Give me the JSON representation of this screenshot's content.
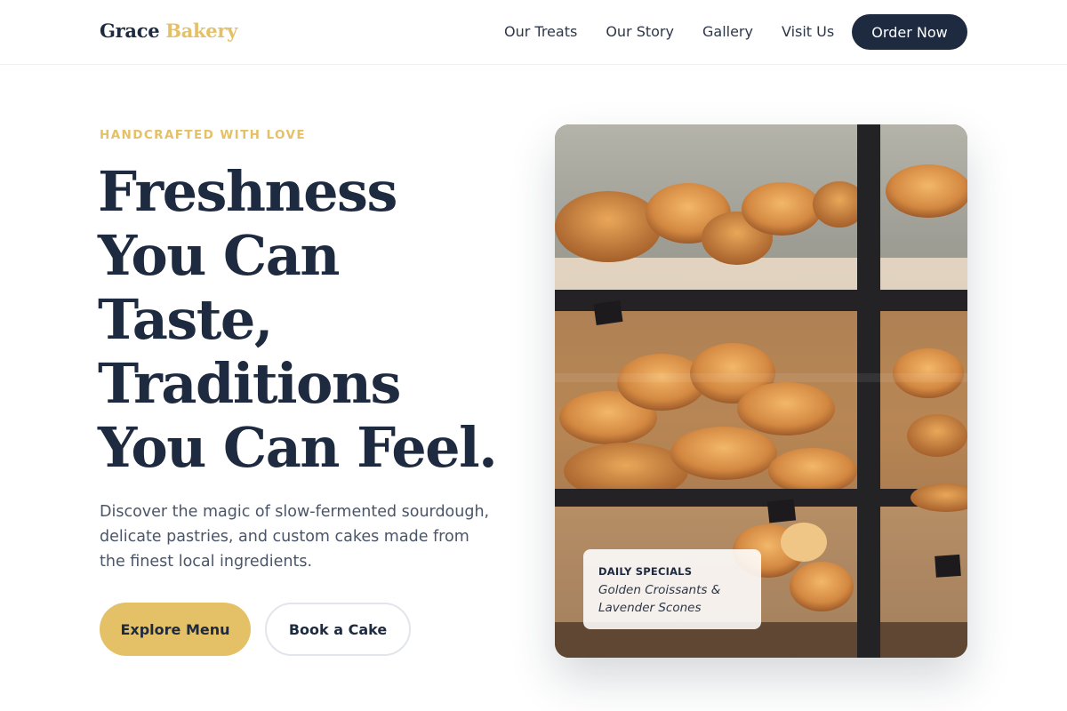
{
  "header": {
    "logo_primary": "Grace",
    "logo_accent": "Bakery",
    "nav": [
      "Our Treats",
      "Our Story",
      "Gallery",
      "Visit Us"
    ],
    "cta_label": "Order Now"
  },
  "hero": {
    "eyebrow": "HANDCRAFTED WITH LOVE",
    "headline_lines": [
      "Freshness",
      "You Can",
      "Taste,",
      "Traditions",
      "You Can Feel."
    ],
    "description": "Discover the magic of slow-fermented sourdough, delicate pastries, and custom cakes made from the finest local ingredients.",
    "primary_button": "Explore Menu",
    "secondary_button": "Book a Cake"
  },
  "image_card": {
    "special_title": "DAILY SPECIALS",
    "special_text": "Golden Croissants & Lavender Scones"
  },
  "colors": {
    "navy": "#1e2a3f",
    "gold": "#e4c067",
    "body_text": "#4a5568"
  }
}
